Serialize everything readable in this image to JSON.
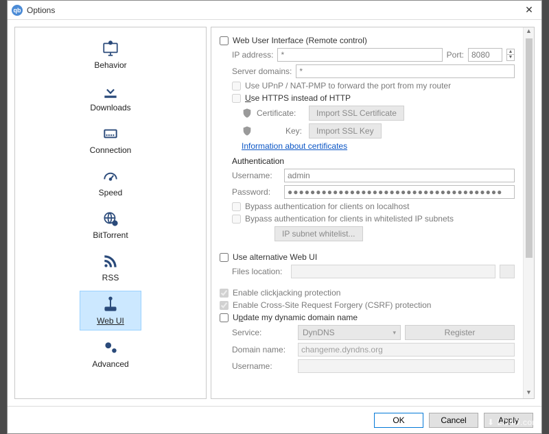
{
  "titlebar": {
    "title": "Options"
  },
  "sidebar": {
    "items": [
      {
        "label": "Behavior"
      },
      {
        "label": "Downloads"
      },
      {
        "label": "Connection"
      },
      {
        "label": "Speed"
      },
      {
        "label": "BitTorrent"
      },
      {
        "label": "RSS"
      },
      {
        "label": "Web UI"
      },
      {
        "label": "Advanced"
      }
    ]
  },
  "panel": {
    "webui_heading": "Web User Interface (Remote control)",
    "ip_label": "IP address:",
    "ip_value": "*",
    "port_label": "Port:",
    "port_value": "8080",
    "server_domains_label": "Server domains:",
    "server_domains_value": "*",
    "upnp_label": "Use UPnP / NAT-PMP to forward the port from my router",
    "https_label": "Use HTTPS instead of HTTP",
    "cert_label": "Certificate:",
    "cert_btn": "Import SSL Certificate",
    "key_label": "Key:",
    "key_btn": "Import SSL Key",
    "info_link": "Information about certificates",
    "auth_heading": "Authentication",
    "user_label": "Username:",
    "user_value": "admin",
    "pass_label": "Password:",
    "pass_value": "●●●●●●●●●●●●●●●●●●●●●●●●●●●●●●●●●●●●●●",
    "bypass_local_label": "Bypass authentication for clients on localhost",
    "bypass_wl_label": "Bypass authentication for clients in whitelisted IP subnets",
    "ip_wl_btn": "IP subnet whitelist...",
    "alt_webui_label": "Use alternative Web UI",
    "files_loc_label": "Files location:",
    "files_loc_value": "",
    "clickjack_label": "Enable clickjacking protection",
    "csrf_label": "Enable Cross-Site Request Forgery (CSRF) protection",
    "update_dns_label": "Update my dynamic domain name",
    "service_label": "Service:",
    "service_value": "DynDNS",
    "register_btn": "Register",
    "domain_label": "Domain name:",
    "domain_value": "changeme.dyndns.org",
    "username2_label": "Username:"
  },
  "buttons": {
    "ok": "OK",
    "cancel": "Cancel",
    "apply": "Apply"
  },
  "watermark": "LO4D.com"
}
